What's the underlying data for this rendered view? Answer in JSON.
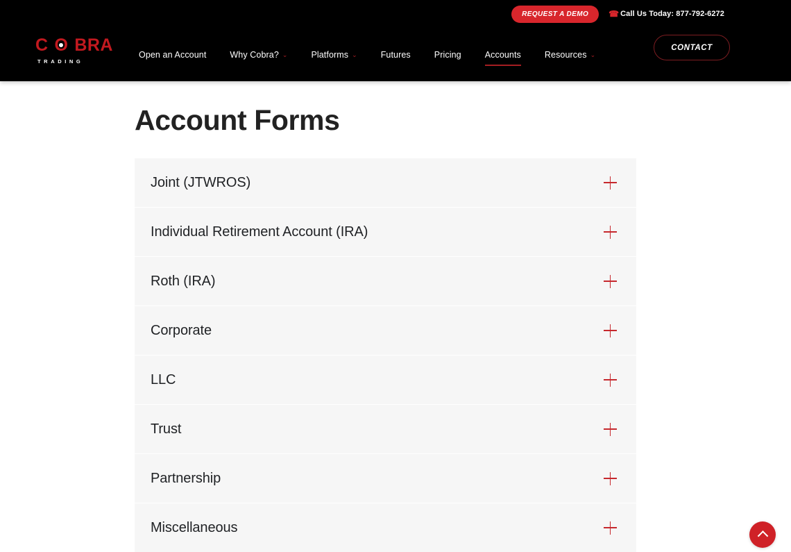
{
  "theme": {
    "brand_red": "#cf2127",
    "demo_red": "#d8262c",
    "header_black": "#000000",
    "row_gray": "#f6f6f6",
    "text_dark": "#1f2124"
  },
  "header": {
    "logo": {
      "word_part1": "C",
      "word_o": "O",
      "word_part2": "BRA",
      "tagline": "TRADING"
    },
    "top_bar": {
      "demo_label": "REQUEST A DEMO",
      "phone_icon": "phone-icon",
      "call_text": "Call Us Today: 877-792-6272"
    },
    "nav": [
      {
        "label": "Open an Account",
        "has_caret": false,
        "active": false
      },
      {
        "label": "Why Cobra?",
        "has_caret": true,
        "active": false
      },
      {
        "label": "Platforms",
        "has_caret": true,
        "active": false
      },
      {
        "label": "Futures",
        "has_caret": false,
        "active": false
      },
      {
        "label": "Pricing",
        "has_caret": false,
        "active": false
      },
      {
        "label": "Accounts",
        "has_caret": false,
        "active": true
      },
      {
        "label": "Resources",
        "has_caret": true,
        "active": false
      }
    ],
    "contact_label": "CONTACT",
    "caret_glyph": "⌄"
  },
  "main": {
    "page_title": "Account Forms",
    "accordion_items": [
      {
        "label": "Joint (JTWROS)",
        "icon": "plus-icon",
        "expanded": false
      },
      {
        "label": "Individual Retirement Account (IRA)",
        "icon": "plus-icon",
        "expanded": false
      },
      {
        "label": "Roth (IRA)",
        "icon": "plus-icon",
        "expanded": false
      },
      {
        "label": "Corporate",
        "icon": "plus-icon",
        "expanded": false
      },
      {
        "label": "LLC",
        "icon": "plus-icon",
        "expanded": false
      },
      {
        "label": "Trust",
        "icon": "plus-icon",
        "expanded": false
      },
      {
        "label": "Partnership",
        "icon": "plus-icon",
        "expanded": false
      },
      {
        "label": "Miscellaneous",
        "icon": "plus-icon",
        "expanded": false
      }
    ]
  },
  "scroll_top": {
    "icon": "chevron-up-icon",
    "label": "Back to top"
  }
}
